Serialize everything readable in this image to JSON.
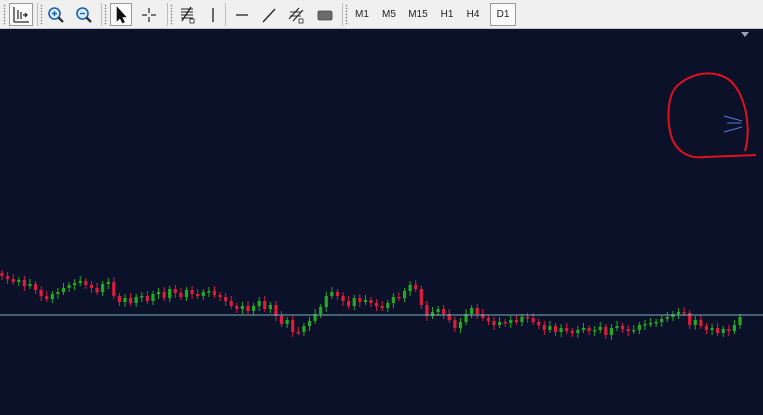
{
  "toolbar": {
    "tools": [
      {
        "id": "chart-shift",
        "icon": "chart-shift-icon",
        "active": true
      },
      {
        "id": "zoom-in",
        "icon": "zoom-in-icon"
      },
      {
        "id": "zoom-out",
        "icon": "zoom-out-icon"
      },
      {
        "id": "cursor",
        "icon": "cursor-arrow-icon",
        "active": true
      },
      {
        "id": "crosshair",
        "icon": "crosshair-icon"
      },
      {
        "id": "fibonacci",
        "icon": "fibonacci-icon"
      },
      {
        "id": "vertical-line",
        "icon": "vertical-line-icon"
      },
      {
        "id": "horizontal-line",
        "icon": "horizontal-line-icon"
      },
      {
        "id": "trendline",
        "icon": "trendline-icon"
      },
      {
        "id": "equidistant-channel",
        "icon": "equidistant-channel-icon"
      },
      {
        "id": "rectangle",
        "icon": "rectangle-icon"
      }
    ],
    "timeframes": [
      {
        "label": "M1",
        "active": false
      },
      {
        "label": "M5",
        "active": false
      },
      {
        "label": "M15",
        "active": false
      },
      {
        "label": "H1",
        "active": false
      },
      {
        "label": "H4",
        "active": false
      },
      {
        "label": "D1",
        "active": true
      }
    ]
  },
  "chart": {
    "background": "#0a1128",
    "bull_color": "#22aa22",
    "bear_color": "#dc1e3c",
    "hline_color": "#7fb0c0",
    "annotation_color": "#e01020",
    "mini_lines_color": "#5a7ad8",
    "close_series": [
      276,
      279,
      282,
      280,
      286,
      284,
      290,
      296,
      299,
      294,
      292,
      288,
      285,
      283,
      281,
      285,
      288,
      292,
      284,
      282,
      296,
      302,
      298,
      303,
      297,
      296,
      301,
      294,
      292,
      298,
      289,
      293,
      297,
      290,
      294,
      296,
      292,
      291,
      295,
      297,
      301,
      306,
      309,
      306,
      311,
      306,
      301,
      309,
      305,
      316,
      324,
      320,
      332,
      332,
      326,
      321,
      314,
      307,
      296,
      292,
      296,
      301,
      306,
      298,
      302,
      300,
      303,
      306,
      308,
      303,
      297,
      298,
      291,
      285,
      289,
      305,
      316,
      312,
      309,
      314,
      320,
      328,
      322,
      314,
      308,
      314,
      318,
      321,
      325,
      322,
      323,
      320,
      322,
      317,
      318,
      322,
      325,
      330,
      326,
      332,
      328,
      331,
      333,
      330,
      328,
      331,
      330,
      327,
      335,
      328,
      326,
      329,
      331,
      330,
      325,
      324,
      323,
      322,
      319,
      317,
      314,
      312,
      313,
      325,
      320,
      326,
      330,
      328,
      333,
      329,
      331,
      325,
      317
    ]
  }
}
